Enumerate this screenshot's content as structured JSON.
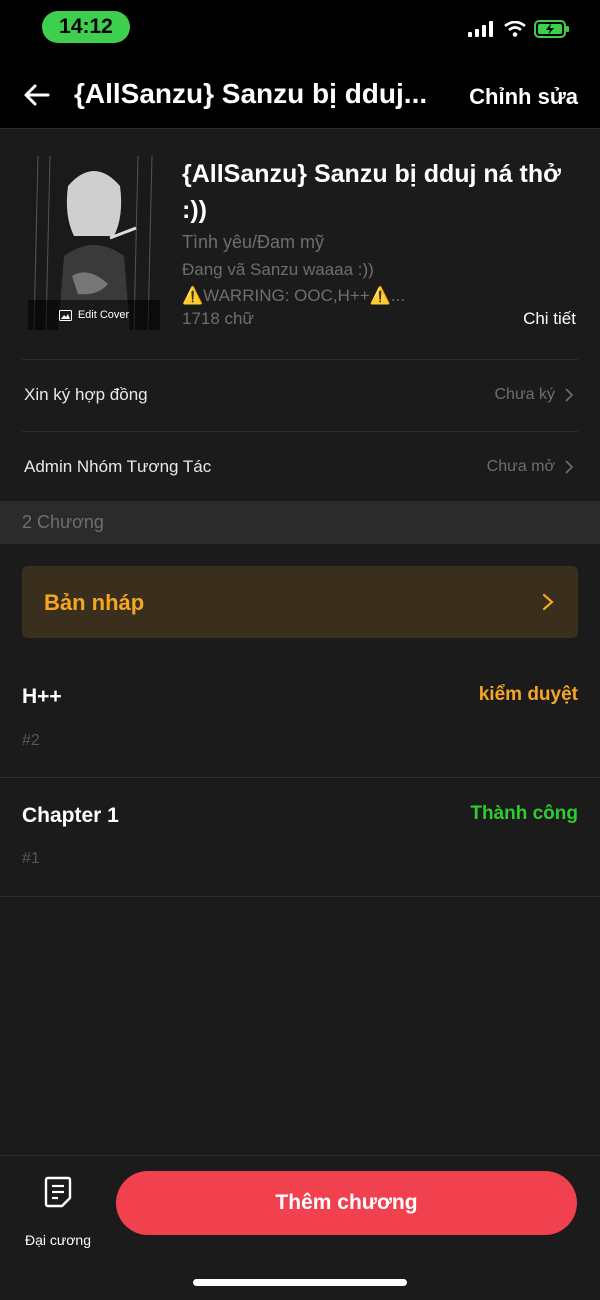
{
  "status_bar": {
    "time": "14:12"
  },
  "header": {
    "title": "{AllSanzu} Sanzu bị dduj...",
    "edit_label": "Chỉnh sửa"
  },
  "book": {
    "cover_label": "Edit Cover",
    "title": "{AllSanzu} Sanzu bị dduj ná thở :))",
    "genre": "Tình yêu/Đam mỹ",
    "description": "Đang vã Sanzu waaaa :))",
    "warning": "⚠️WARRING: OOC,H++⚠️...",
    "word_count": "1718 chữ",
    "details_label": "Chi tiết"
  },
  "settings": [
    {
      "label": "Xin ký hợp đồng",
      "value": "Chưa ký"
    },
    {
      "label": "Admin Nhóm Tương Tác",
      "value": "Chưa mở"
    }
  ],
  "chapters_header": "2 Chương",
  "draft_label": "Bản nháp",
  "chapters": [
    {
      "title": "H++",
      "number": "#2",
      "status": "kiểm duyệt",
      "status_color": "#f5a623"
    },
    {
      "title": "Chapter 1",
      "number": "#1",
      "status": "Thành công",
      "status_color": "#2ecc2e"
    }
  ],
  "bottom": {
    "outline_label": "Đại cương",
    "add_chapter_label": "Thêm chương"
  },
  "colors": {
    "accent": "#f2414e",
    "draft_text": "#f5a623",
    "success": "#2ecc2e"
  }
}
